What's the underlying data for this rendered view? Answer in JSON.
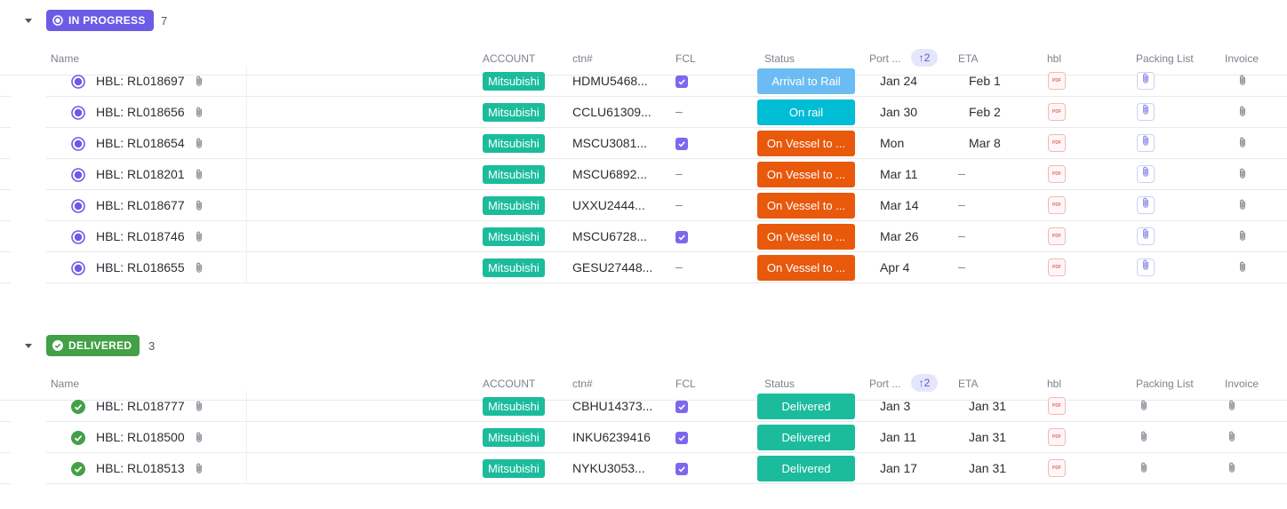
{
  "columns": {
    "name": "Name",
    "account": "ACCOUNT",
    "ctn": "ctn#",
    "fcl": "FCL",
    "status": "Status",
    "port": "Port ...",
    "sort_badge": "↑2",
    "eta": "ETA",
    "hbl": "hbl",
    "packing": "Packing List",
    "invoice": "Invoice"
  },
  "icons": {
    "caret": "caret-down-icon",
    "attachment": "paperclip-icon",
    "pdf": "pdf-file-icon",
    "checkbox": "checkbox-checked-icon",
    "in_progress": "in-progress-circle-icon",
    "complete": "check-circle-icon"
  },
  "colors": {
    "in_progress": "#6b5be5",
    "delivered": "#43a047",
    "account_tag": "#1bbc9c",
    "arrival_to_rail": "#6bbcf2",
    "on_rail": "#00bcd4",
    "on_vessel": "#e8590c",
    "delivered_chip": "#1bbc9c"
  },
  "groups": [
    {
      "label": "IN PROGRESS",
      "count": "7",
      "tasks": [
        {
          "name": "HBL: RL018697",
          "account": "Mitsubishi",
          "ctn": "HDMU5468...",
          "fcl": true,
          "status": "Arrival to Rail",
          "status_color": "#6bbcf2",
          "port": "Jan 24",
          "eta": "Feb 1",
          "hbl": "PDF",
          "packing_attached": true
        },
        {
          "name": "HBL: RL018656",
          "account": "Mitsubishi",
          "ctn": "CCLU61309...",
          "fcl": false,
          "status": "On rail",
          "status_color": "#00bcd4",
          "port": "Jan 30",
          "eta": "Feb 2",
          "hbl": "PDF",
          "packing_attached": true
        },
        {
          "name": "HBL: RL018654",
          "account": "Mitsubishi",
          "ctn": "MSCU3081...",
          "fcl": true,
          "status": "On Vessel to ...",
          "status_color": "#e8590c",
          "port": "Mon",
          "eta": "Mar 8",
          "hbl": "PDF",
          "packing_attached": true
        },
        {
          "name": "HBL: RL018201",
          "account": "Mitsubishi",
          "ctn": "MSCU6892...",
          "fcl": false,
          "status": "On Vessel to ...",
          "status_color": "#e8590c",
          "port": "Mar 11",
          "eta": "–",
          "hbl": "PDF",
          "packing_attached": true
        },
        {
          "name": "HBL: RL018677",
          "account": "Mitsubishi",
          "ctn": "UXXU2444...",
          "fcl": false,
          "status": "On Vessel to ...",
          "status_color": "#e8590c",
          "port": "Mar 14",
          "eta": "–",
          "hbl": "PDF",
          "packing_attached": true
        },
        {
          "name": "HBL: RL018746",
          "account": "Mitsubishi",
          "ctn": "MSCU6728...",
          "fcl": true,
          "status": "On Vessel to ...",
          "status_color": "#e8590c",
          "port": "Mar 26",
          "eta": "–",
          "hbl": "PDF",
          "packing_attached": true
        },
        {
          "name": "HBL: RL018655",
          "account": "Mitsubishi",
          "ctn": "GESU27448...",
          "fcl": false,
          "status": "On Vessel to ...",
          "status_color": "#e8590c",
          "port": "Apr 4",
          "eta": "–",
          "hbl": "PDF",
          "packing_attached": true
        }
      ]
    },
    {
      "label": "DELIVERED",
      "count": "3",
      "tasks": [
        {
          "name": "HBL: RL018777",
          "account": "Mitsubishi",
          "ctn": "CBHU14373...",
          "fcl": true,
          "status": "Delivered",
          "status_color": "#1bbc9c",
          "port": "Jan 3",
          "eta": "Jan 31",
          "hbl": "PDF",
          "packing_attached": false
        },
        {
          "name": "HBL: RL018500",
          "account": "Mitsubishi",
          "ctn": "INKU6239416",
          "fcl": true,
          "status": "Delivered",
          "status_color": "#1bbc9c",
          "port": "Jan 11",
          "eta": "Jan 31",
          "hbl": "PDF",
          "packing_attached": false
        },
        {
          "name": "HBL: RL018513",
          "account": "Mitsubishi",
          "ctn": "NYKU3053...",
          "fcl": true,
          "status": "Delivered",
          "status_color": "#1bbc9c",
          "port": "Jan 17",
          "eta": "Jan 31",
          "hbl": "PDF",
          "packing_attached": false
        }
      ]
    }
  ]
}
